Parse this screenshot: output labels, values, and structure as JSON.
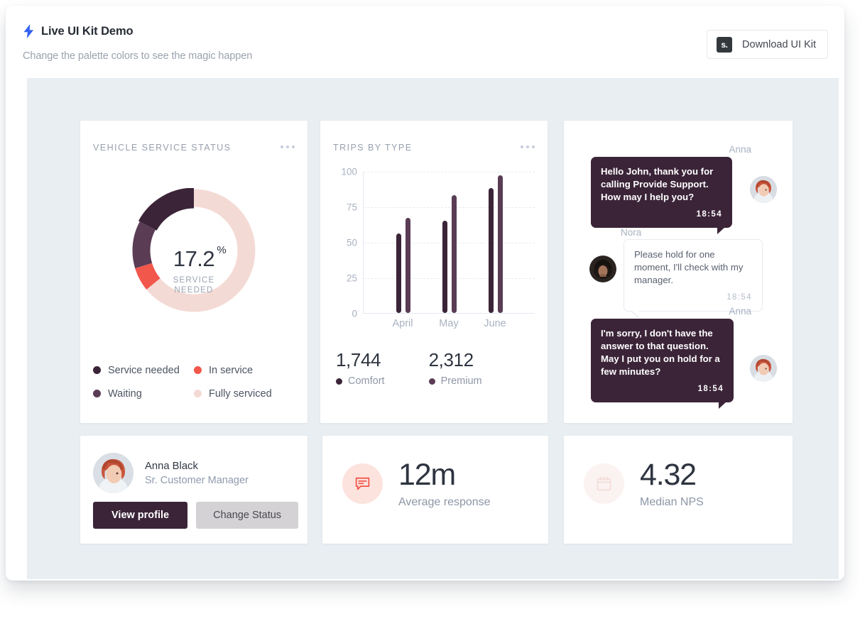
{
  "header": {
    "logo_icon": "lightning-bolt-icon",
    "title": "Live UI Kit Demo",
    "subtitle": "Change the palette colors to see the magic happen",
    "download_button": {
      "badge": "s.",
      "label": "Download UI Kit"
    }
  },
  "colors": {
    "dark_plum": "#3b2438",
    "mid_plum": "#5a3c55",
    "coral": "#f2574c",
    "blush": "#f4dad5",
    "page_panel": "#e9eef2",
    "accent_blue": "#3461f0"
  },
  "donut_card": {
    "title": "VEHICLE SERVICE STATUS",
    "menu_icon": "ellipsis-icon",
    "center_value": "17.2",
    "center_unit": "%",
    "center_label_line1": "SERVICE",
    "center_label_line2": "NEEDED",
    "legend": [
      {
        "label": "Service needed",
        "color": "#3b2438"
      },
      {
        "label": "In service",
        "color": "#f2574c"
      },
      {
        "label": "Waiting",
        "color": "#5a3c55"
      },
      {
        "label": "Fully serviced",
        "color": "#f4dad5"
      }
    ],
    "chart_data": {
      "type": "pie",
      "title": "VEHICLE SERVICE STATUS",
      "labels": [
        "Service needed",
        "Waiting",
        "In service",
        "Fully serviced"
      ],
      "values": [
        17.2,
        12.5,
        6.3,
        64.0
      ],
      "colors": [
        "#3b2438",
        "#5a3c55",
        "#f2574c",
        "#f4dad5"
      ],
      "legend": "bottom"
    }
  },
  "bars_card": {
    "title": "TRIPS BY TYPE",
    "menu_icon": "ellipsis-icon",
    "stats": [
      {
        "value": "1,744",
        "label": "Comfort",
        "color": "#3b2438"
      },
      {
        "value": "2,312",
        "label": "Premium",
        "color": "#5a3c55"
      }
    ],
    "chart_data": {
      "type": "bar",
      "title": "TRIPS BY TYPE",
      "categories": [
        "April",
        "May",
        "June"
      ],
      "series": [
        {
          "name": "Comfort",
          "values": [
            56,
            65,
            88
          ],
          "color": "#3b2438"
        },
        {
          "name": "Premium",
          "values": [
            67,
            83,
            97
          ],
          "color": "#5a3c55"
        }
      ],
      "yticks": [
        0,
        25,
        50,
        75,
        100
      ],
      "ylim": [
        0,
        100
      ],
      "xlabel": "",
      "ylabel": "",
      "grid": true,
      "legend": "below-as-stats"
    }
  },
  "chat_card": {
    "messages": [
      {
        "sender": "Anna",
        "side": "right",
        "text": "Hello John, thank you for calling Provide Support. How may I help you?",
        "time": "18:54",
        "avatar": "anna-avatar"
      },
      {
        "sender": "Nora",
        "side": "left",
        "text": "Please hold for one moment, I'll check with my manager.",
        "time": "18:54",
        "avatar": "nora-avatar"
      },
      {
        "sender": "Anna",
        "side": "right",
        "text": "I'm sorry, I don't have the answer to that question. May I put you on hold for a few minutes?",
        "time": "18:54",
        "avatar": "anna-avatar"
      }
    ]
  },
  "profile_card": {
    "avatar": "anna-black-avatar",
    "name": "Anna Black",
    "role": "Sr. Customer Manager",
    "primary_button": "View profile",
    "secondary_button": "Change Status"
  },
  "metric_cards": [
    {
      "icon": "chat-bubble-icon",
      "icon_bg": "#fde3de",
      "icon_color": "#f2574c",
      "value": "12m",
      "label": "Average response"
    },
    {
      "icon": "calendar-icon",
      "icon_bg": "#fbf3f1",
      "icon_color": "#f5ded9",
      "value": "4.32",
      "label": "Median NPS"
    }
  ]
}
